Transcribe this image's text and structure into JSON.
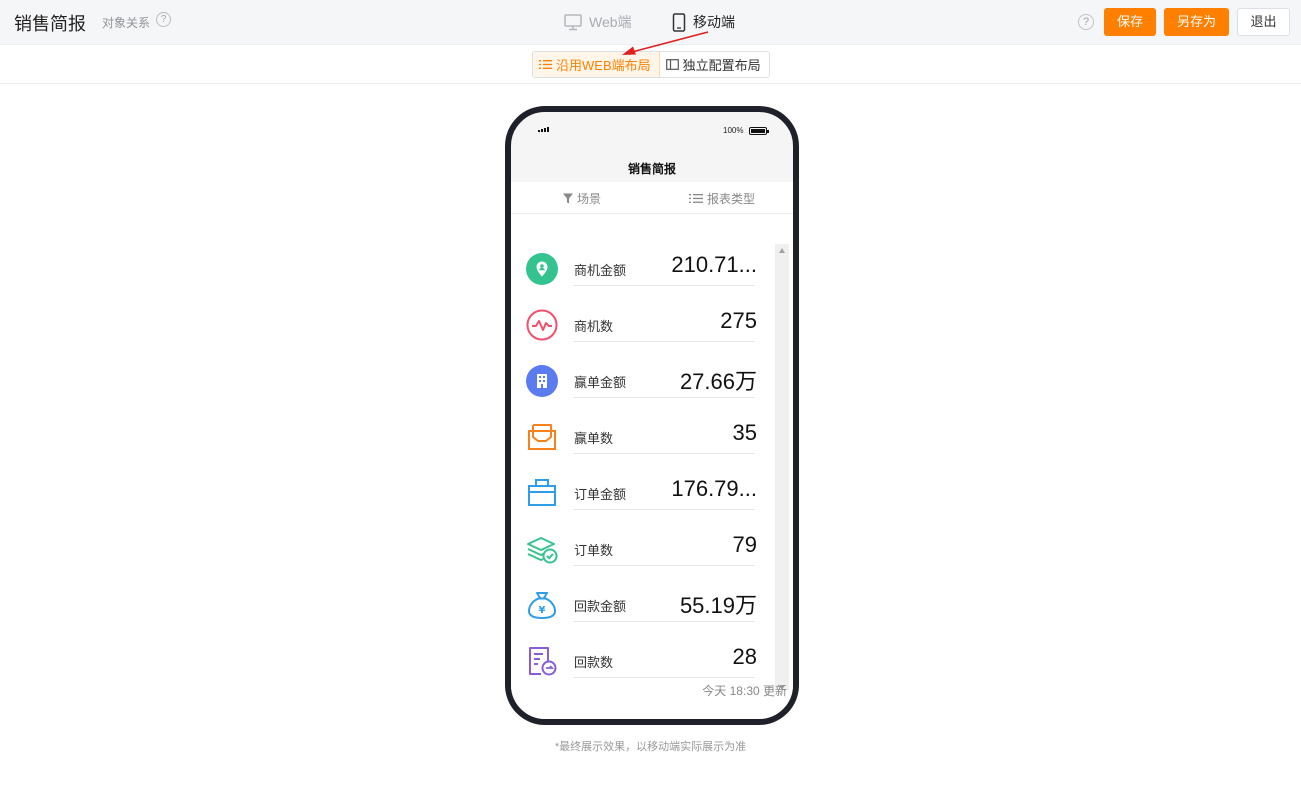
{
  "header": {
    "title": "销售简报",
    "object_relation": "对象关系",
    "help_glyph": "?",
    "modes": [
      {
        "label": "Web端",
        "icon": "monitor-icon",
        "active": false
      },
      {
        "label": "移动端",
        "icon": "mobile-phone-icon",
        "active": true
      }
    ],
    "buttons": {
      "save": "保存",
      "save_as": "另存为",
      "exit": "退出"
    }
  },
  "layout_toggle": {
    "use_web": "沿用WEB端布局",
    "independent": "独立配置布局",
    "selected": "use_web"
  },
  "phone": {
    "battery_percent": "100%",
    "title": "销售简报",
    "filters": {
      "scene": "场景",
      "report_type": "报表类型"
    },
    "metrics": [
      {
        "label": "商机金额",
        "value": "210.71...",
        "icon": "map-pin-icon",
        "color": "#34c38f"
      },
      {
        "label": "商机数",
        "value": "275",
        "icon": "pulse-icon",
        "color": "#f0506e"
      },
      {
        "label": "赢单金额",
        "value": "27.66万",
        "icon": "building-icon",
        "color": "#5b7cf0"
      },
      {
        "label": "赢单数",
        "value": "35",
        "icon": "inbox-icon",
        "color": "#f5821f"
      },
      {
        "label": "订单金额",
        "value": "176.79...",
        "icon": "briefcase-icon",
        "color": "#2f9de8"
      },
      {
        "label": "订单数",
        "value": "79",
        "icon": "stack-check-icon",
        "color": "#34c38f"
      },
      {
        "label": "回款金额",
        "value": "55.19万",
        "icon": "money-bag-icon",
        "color": "#2f9de8"
      },
      {
        "label": "回款数",
        "value": "28",
        "icon": "document-arrow-icon",
        "color": "#8a5cd6"
      }
    ],
    "updated_text": "今天 18:30 更新"
  },
  "footnote": "*最终展示效果，以移动端实际展示为准",
  "colors": {
    "accent": "#ff8000",
    "annotation_arrow": "#e02020"
  }
}
